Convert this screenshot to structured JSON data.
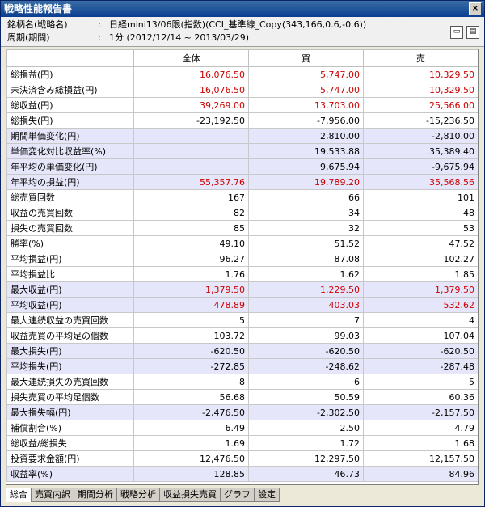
{
  "window": {
    "title": "戦略性能報告書",
    "close_label": "×"
  },
  "info": {
    "name_label": "銘柄名(戦略名)",
    "name_value": "日経mini13/06限(指数)(CCI_基準線_Copy(343,166,0.6,-0.6))",
    "period_label": "周期(期間)",
    "period_value": "1分 (2012/12/14 ~ 2013/03/29)",
    "separator": ":"
  },
  "table": {
    "headers": [
      "",
      "全体",
      "買",
      "売"
    ],
    "rows": [
      {
        "label": "総損益(円)",
        "values": [
          "16,076.50",
          "5,747.00",
          "10,329.50"
        ],
        "red": true,
        "hl": false
      },
      {
        "label": "未決済含み総損益(円)",
        "values": [
          "16,076.50",
          "5,747.00",
          "10,329.50"
        ],
        "red": true,
        "hl": false
      },
      {
        "label": "総収益(円)",
        "values": [
          "39,269.00",
          "13,703.00",
          "25,566.00"
        ],
        "red": true,
        "hl": false
      },
      {
        "label": "総損失(円)",
        "values": [
          "-23,192.50",
          "-7,956.00",
          "-15,236.50"
        ],
        "red": false,
        "hl": false
      },
      {
        "label": "期間単価変化(円)",
        "values": [
          "",
          "2,810.00",
          "-2,810.00"
        ],
        "red": false,
        "hl": true
      },
      {
        "label": "単価変化対比収益率(%)",
        "values": [
          "",
          "19,533.88",
          "35,389.40"
        ],
        "red": false,
        "hl": true
      },
      {
        "label": "年平均の単価変化(円)",
        "values": [
          "",
          "9,675.94",
          "-9,675.94"
        ],
        "red": false,
        "hl": true
      },
      {
        "label": "年平均の損益(円)",
        "values": [
          "55,357.76",
          "19,789.20",
          "35,568.56"
        ],
        "red": true,
        "hl": true
      },
      {
        "label": "総売買回数",
        "values": [
          "167",
          "66",
          "101"
        ],
        "red": false,
        "hl": false
      },
      {
        "label": "収益の売買回数",
        "values": [
          "82",
          "34",
          "48"
        ],
        "red": false,
        "hl": false
      },
      {
        "label": "損失の売買回数",
        "values": [
          "85",
          "32",
          "53"
        ],
        "red": false,
        "hl": false
      },
      {
        "label": "勝率(%)",
        "values": [
          "49.10",
          "51.52",
          "47.52"
        ],
        "red": false,
        "hl": false
      },
      {
        "label": "平均損益(円)",
        "values": [
          "96.27",
          "87.08",
          "102.27"
        ],
        "red": false,
        "hl": false
      },
      {
        "label": "平均損益比",
        "values": [
          "1.76",
          "1.62",
          "1.85"
        ],
        "red": false,
        "hl": false
      },
      {
        "label": "最大収益(円)",
        "values": [
          "1,379.50",
          "1,229.50",
          "1,379.50"
        ],
        "red": true,
        "hl": true
      },
      {
        "label": "平均収益(円)",
        "values": [
          "478.89",
          "403.03",
          "532.62"
        ],
        "red": true,
        "hl": true
      },
      {
        "label": "最大連続収益の売買回数",
        "values": [
          "5",
          "7",
          "4"
        ],
        "red": false,
        "hl": false
      },
      {
        "label": "収益売買の平均足の個数",
        "values": [
          "103.72",
          "99.03",
          "107.04"
        ],
        "red": false,
        "hl": false
      },
      {
        "label": "最大損失(円)",
        "values": [
          "-620.50",
          "-620.50",
          "-620.50"
        ],
        "red": false,
        "hl": true
      },
      {
        "label": "平均損失(円)",
        "values": [
          "-272.85",
          "-248.62",
          "-287.48"
        ],
        "red": false,
        "hl": true
      },
      {
        "label": "最大連続損失の売買回数",
        "values": [
          "8",
          "6",
          "5"
        ],
        "red": false,
        "hl": false
      },
      {
        "label": "損失売買の平均足個数",
        "values": [
          "56.68",
          "50.59",
          "60.36"
        ],
        "red": false,
        "hl": false
      },
      {
        "label": "最大損失幅(円)",
        "values": [
          "-2,476.50",
          "-2,302.50",
          "-2,157.50"
        ],
        "red": false,
        "hl": true
      },
      {
        "label": "補償割合(%)",
        "values": [
          "6.49",
          "2.50",
          "4.79"
        ],
        "red": false,
        "hl": false
      },
      {
        "label": "総収益/総損失",
        "values": [
          "1.69",
          "1.72",
          "1.68"
        ],
        "red": false,
        "hl": false
      },
      {
        "label": "投資要求金額(円)",
        "values": [
          "12,476.50",
          "12,297.50",
          "12,157.50"
        ],
        "red": false,
        "hl": false
      },
      {
        "label": "収益率(%)",
        "values": [
          "128.85",
          "46.73",
          "84.96"
        ],
        "red": false,
        "hl": true
      }
    ]
  },
  "tabs": [
    "総合",
    "売買内訳",
    "期間分析",
    "戦略分析",
    "収益損失売買",
    "グラフ",
    "設定"
  ],
  "colors": {
    "profit": "#cc0000",
    "highlight_row": "#e6e6fa",
    "titlebar": "#0a3d91"
  }
}
